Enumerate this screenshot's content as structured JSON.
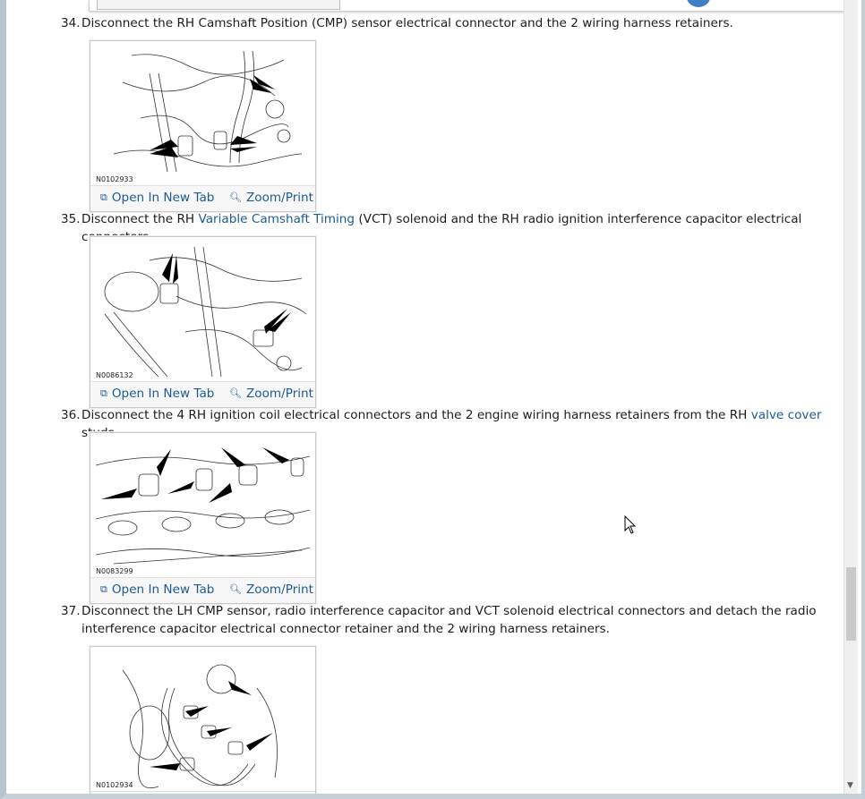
{
  "steps": [
    {
      "num": "34.",
      "parts": [
        {
          "t": "Disconnect the RH Camshaft Position (CMP) sensor electrical connector and the 2 wiring harness retainers."
        }
      ],
      "figure_code": "N0102933"
    },
    {
      "num": "35.",
      "parts": [
        {
          "t": "Disconnect the RH "
        },
        {
          "t": "Variable Camshaft Timing",
          "link": true
        },
        {
          "t": " (VCT) solenoid and the RH radio ignition interference capacitor electrical connectors."
        }
      ],
      "figure_code": "N0086132"
    },
    {
      "num": "36.",
      "parts": [
        {
          "t": "Disconnect the 4 RH ignition coil electrical connectors and the 2 engine wiring harness retainers from the RH "
        },
        {
          "t": "valve cover",
          "link": true
        },
        {
          "t": " studs."
        }
      ],
      "figure_code": "N0083299"
    },
    {
      "num": "37.",
      "parts": [
        {
          "t": "Disconnect the LH CMP sensor, radio interference capacitor and VCT solenoid electrical connectors and detach the radio interference capacitor electrical connector retainer and the 2 wiring harness retainers."
        }
      ],
      "figure_code": "N0102934"
    }
  ],
  "actions": {
    "open_new_tab": "Open In New Tab",
    "zoom_print": "Zoom/Print"
  },
  "icons": {
    "open_new_tab": "open-new-tab-icon",
    "zoom_print": "magnifier-zoom-icon",
    "scroll_down": "scroll-down-arrow-icon",
    "cursor": "mouse-pointer-icon"
  },
  "colors": {
    "link": "#1e5a96",
    "text": "#1c1c1c",
    "window_frame": "#b9c4cf"
  }
}
